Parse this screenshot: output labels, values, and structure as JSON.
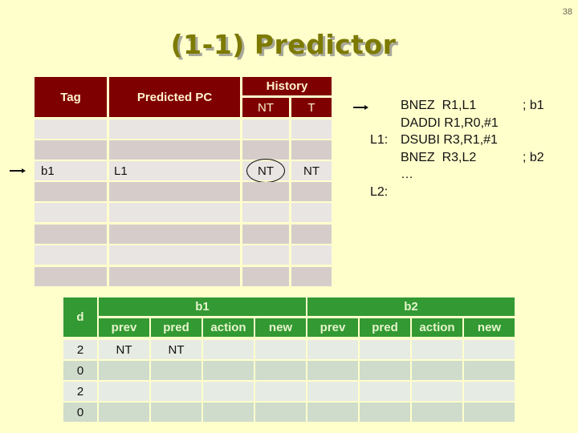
{
  "page_number": "38",
  "title": "(1-1) Predictor",
  "btb_table": {
    "headers": {
      "tag": "Tag",
      "predicted_pc": "Predicted PC",
      "history": "History",
      "history_sub": [
        "NT",
        "T"
      ]
    },
    "rows": [
      {
        "tag": "",
        "pc": "",
        "h0": "",
        "h1": ""
      },
      {
        "tag": "",
        "pc": "",
        "h0": "",
        "h1": ""
      },
      {
        "tag": "b1",
        "pc": "L1",
        "h0": "NT",
        "h1": "NT",
        "current": true,
        "circled": "h0"
      },
      {
        "tag": "",
        "pc": "",
        "h0": "",
        "h1": ""
      },
      {
        "tag": "",
        "pc": "",
        "h0": "",
        "h1": ""
      },
      {
        "tag": "",
        "pc": "",
        "h0": "",
        "h1": ""
      },
      {
        "tag": "",
        "pc": "",
        "h0": "",
        "h1": ""
      },
      {
        "tag": "",
        "pc": "",
        "h0": "",
        "h1": ""
      }
    ]
  },
  "code": {
    "lines": [
      {
        "label": "",
        "instr": "BNEZ  R1,L1",
        "comment": "; b1",
        "current": true
      },
      {
        "label": "",
        "instr": "DADDI R1,R0,#1",
        "comment": ""
      },
      {
        "label": "L1:",
        "instr": "DSUBI R3,R1,#1",
        "comment": ""
      },
      {
        "label": "",
        "instr": "BNEZ  R3,L2",
        "comment": "; b2"
      },
      {
        "label": "",
        "instr": "…",
        "comment": ""
      },
      {
        "label": "L2:",
        "instr": "",
        "comment": ""
      }
    ]
  },
  "trace_table": {
    "headers": {
      "d": "d",
      "groups": [
        "b1",
        "b2"
      ],
      "sub": [
        "prev",
        "pred",
        "action",
        "new"
      ]
    },
    "rows": [
      {
        "d": "2",
        "b1": [
          "NT",
          "NT",
          "",
          ""
        ],
        "b2": [
          "",
          "",
          "",
          ""
        ]
      },
      {
        "d": "0",
        "b1": [
          "",
          "",
          "",
          ""
        ],
        "b2": [
          "",
          "",
          "",
          ""
        ]
      },
      {
        "d": "2",
        "b1": [
          "",
          "",
          "",
          ""
        ],
        "b2": [
          "",
          "",
          "",
          ""
        ]
      },
      {
        "d": "0",
        "b1": [
          "",
          "",
          "",
          ""
        ],
        "b2": [
          "",
          "",
          "",
          ""
        ]
      }
    ]
  }
}
